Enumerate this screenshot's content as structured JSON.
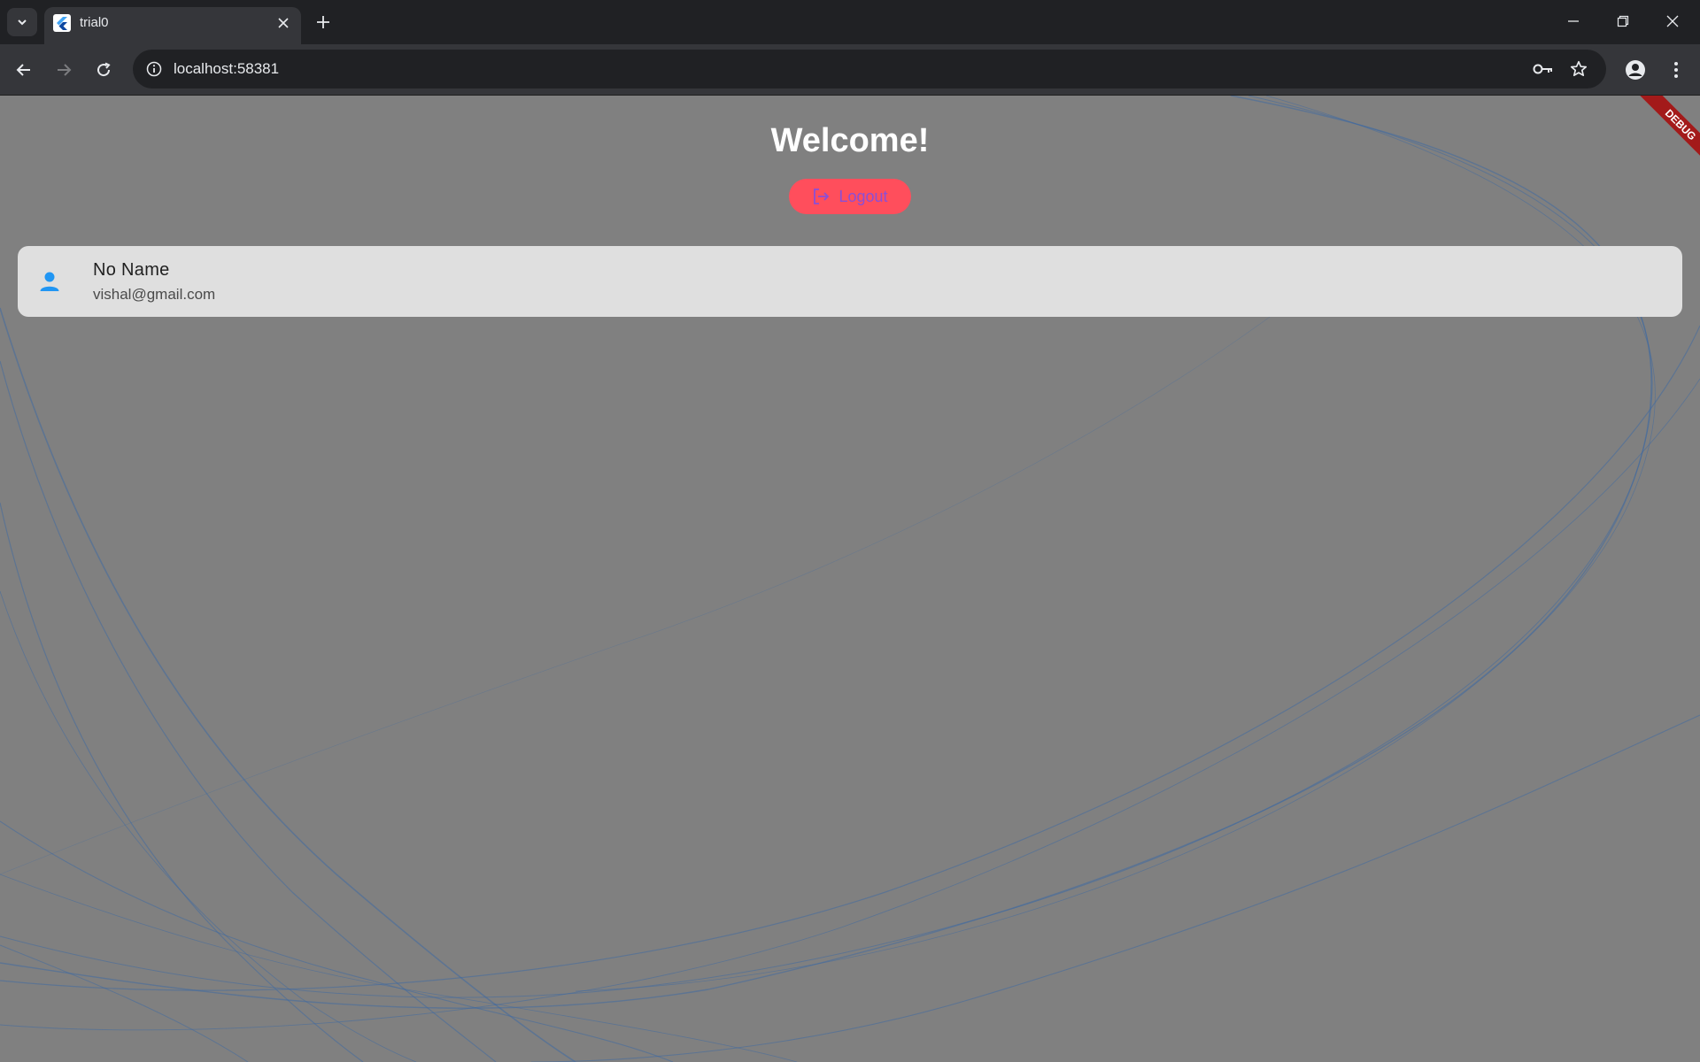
{
  "browser": {
    "tab_title": "trial0",
    "url": "localhost:58381"
  },
  "page": {
    "title": "Welcome!",
    "logout_label": "Logout",
    "debug_label": "DEBUG",
    "user": {
      "name": "No Name",
      "email": "vishal@gmail.com"
    }
  },
  "icons": {
    "tab_search": "chevron-down-icon",
    "favicon": "flutter-icon",
    "close_tab": "close-icon",
    "new_tab": "plus-icon",
    "back": "arrow-left-icon",
    "forward": "arrow-right-icon",
    "reload": "reload-icon",
    "site_info": "info-icon",
    "password": "key-icon",
    "bookmark": "star-icon",
    "profile": "person-icon",
    "menu": "kebab-menu-icon",
    "logout": "logout-icon",
    "user": "person-icon"
  },
  "colors": {
    "page_background": "#808080",
    "logout_button": "#ff4e5c",
    "logout_text": "#8b4fd6",
    "user_icon": "#2196f3",
    "card_background": "#dfdfdf",
    "debug_ribbon": "#a31a1a"
  }
}
